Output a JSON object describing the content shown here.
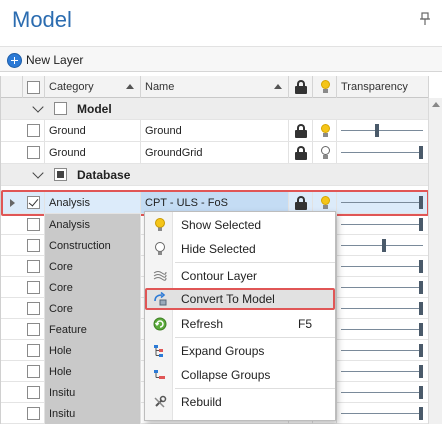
{
  "panel": {
    "title": "Model"
  },
  "toolbar": {
    "new_layer_label": "New Layer"
  },
  "columns": {
    "category": "Category",
    "name": "Name",
    "transparency": "Transparency"
  },
  "groups": {
    "model": "Model",
    "database": "Database"
  },
  "model_rows": [
    {
      "category": "Ground",
      "name": "Ground",
      "checked": false,
      "locked": true,
      "visible": true,
      "transparency": 0.43
    },
    {
      "category": "Ground",
      "name": "GroundGrid",
      "checked": false,
      "locked": true,
      "visible": false,
      "transparency": 1.0
    }
  ],
  "selected_row": {
    "category": "Analysis",
    "name": "CPT - ULS - FoS",
    "checked": true,
    "locked": true,
    "visible": true,
    "transparency": 1.0
  },
  "database_rows": [
    {
      "category": "Analysis",
      "transparency": 1.0
    },
    {
      "category": "Construction",
      "transparency": 0.53
    },
    {
      "category": "Core",
      "transparency": 1.0
    },
    {
      "category": "Core",
      "transparency": 1.0
    },
    {
      "category": "Core",
      "transparency": 1.0
    },
    {
      "category": "Feature",
      "transparency": 1.0
    },
    {
      "category": "Hole",
      "transparency": 1.0
    },
    {
      "category": "Hole",
      "transparency": 1.0
    },
    {
      "category": "Insitu",
      "transparency": 1.0
    },
    {
      "category": "Insitu",
      "transparency": 1.0
    }
  ],
  "context_menu": {
    "show_selected": "Show Selected",
    "hide_selected": "Hide Selected",
    "contour_layer": "Contour Layer",
    "convert_to_model": "Convert To Model",
    "refresh": "Refresh",
    "refresh_shortcut": "F5",
    "expand_groups": "Expand Groups",
    "collapse_groups": "Collapse Groups",
    "rebuild": "Rebuild"
  },
  "colors": {
    "accent": "#2b6cb0",
    "highlight_frame": "#e05656",
    "selected_row": "#dcebfa"
  }
}
